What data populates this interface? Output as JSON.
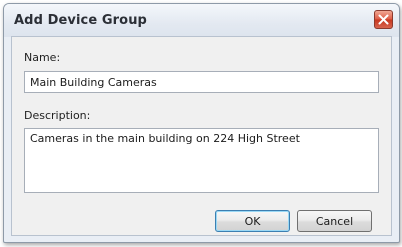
{
  "window": {
    "title": "Add Device Group",
    "close_icon": "close-x-icon"
  },
  "form": {
    "name_label": "Name:",
    "name_value": "Main Building Cameras",
    "description_label": "Description:",
    "description_value": "Cameras in the main building on 224 High Street"
  },
  "buttons": {
    "ok_label": "OK",
    "cancel_label": "Cancel"
  },
  "colors": {
    "close_button": "#d24a36",
    "default_button_border": "#3c7fb1"
  }
}
